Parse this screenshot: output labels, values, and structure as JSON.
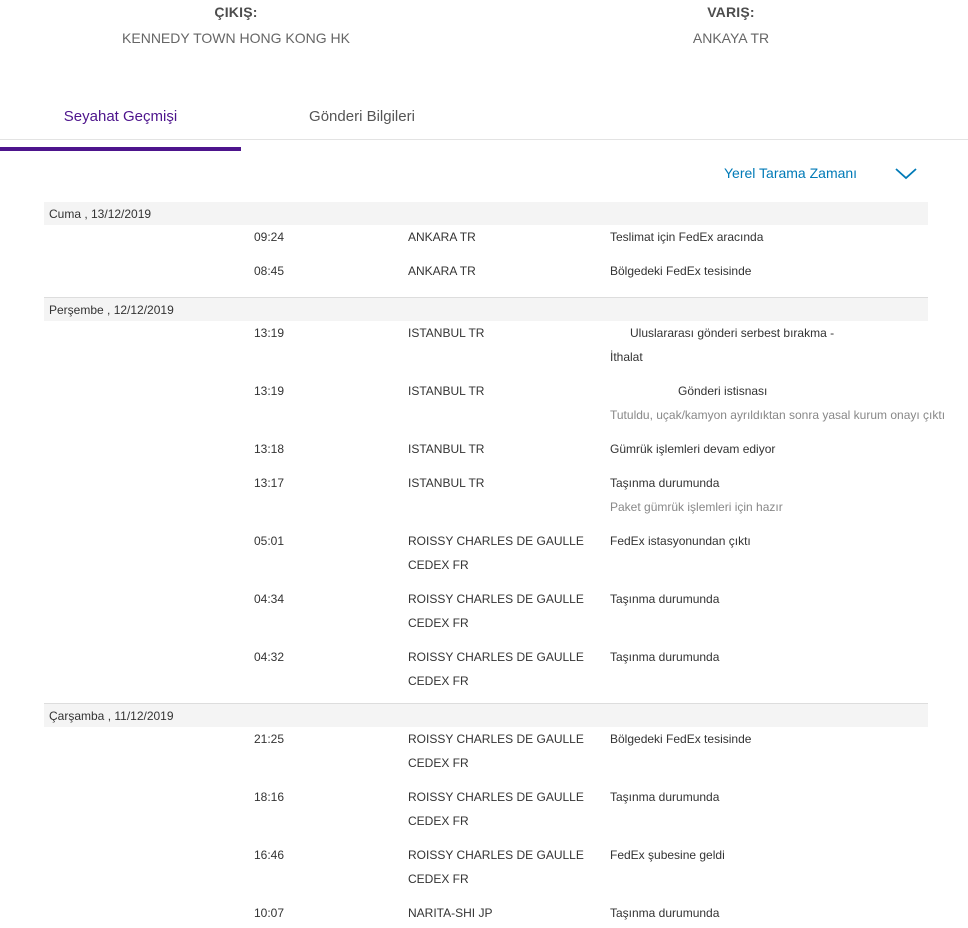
{
  "route": {
    "origin_label": "ÇIKIŞ:",
    "origin_value": "KENNEDY TOWN HONG KONG HK",
    "dest_label": "VARIŞ:",
    "dest_value": "ANKAYA TR"
  },
  "tabs": {
    "travel_history": "Seyahat Geçmişi",
    "shipment_info": "Gönderi Bilgileri"
  },
  "sort": {
    "label": "Yerel Tarama Zamanı",
    "icon": "chevron-down-icon",
    "color": "#007ab7"
  },
  "accent_color": "#4d148c",
  "history": [
    {
      "date": "Cuma , 13/12/2019",
      "events": [
        {
          "time": "09:24",
          "location": "ANKARA TR",
          "status": "Teslimat için FedEx aracında"
        },
        {
          "time": "08:45",
          "location": "ANKARA TR",
          "status": "Bölgedeki FedEx tesisinde"
        }
      ]
    },
    {
      "date": "Perşembe , 12/12/2019",
      "events": [
        {
          "time": "13:19",
          "location": "ISTANBUL TR",
          "status": "Uluslararası gönderi serbest bırakma -",
          "status_line2": "İthalat"
        },
        {
          "time": "13:19",
          "location": "ISTANBUL TR",
          "status": "Gönderi istisnası",
          "detail": "Tutuldu, uçak/kamyon ayrıldıktan sonra yasal kurum onayı çıktı"
        },
        {
          "time": "13:18",
          "location": "ISTANBUL TR",
          "status": "Gümrük işlemleri devam ediyor"
        },
        {
          "time": "13:17",
          "location": "ISTANBUL TR",
          "status": "Taşınma durumunda",
          "detail": "Paket gümrük işlemleri için hazır"
        },
        {
          "time": "05:01",
          "location": "ROISSY CHARLES DE GAULLE",
          "location_line2": "CEDEX FR",
          "status": "FedEx istasyonundan çıktı"
        },
        {
          "time": "04:34",
          "location": "ROISSY CHARLES DE GAULLE",
          "location_line2": "CEDEX FR",
          "status": "Taşınma durumunda"
        },
        {
          "time": "04:32",
          "location": "ROISSY CHARLES DE GAULLE",
          "location_line2": "CEDEX FR",
          "status": "Taşınma durumunda"
        }
      ]
    },
    {
      "date": "Çarşamba , 11/12/2019",
      "events": [
        {
          "time": "21:25",
          "location": "ROISSY CHARLES DE GAULLE",
          "location_line2": "CEDEX FR",
          "status": "Bölgedeki FedEx tesisinde"
        },
        {
          "time": "18:16",
          "location": "ROISSY CHARLES DE GAULLE",
          "location_line2": "CEDEX FR",
          "status": "Taşınma durumunda"
        },
        {
          "time": "16:46",
          "location": "ROISSY CHARLES DE GAULLE",
          "location_line2": "CEDEX FR",
          "status": "FedEx şubesine geldi"
        },
        {
          "time": "10:07",
          "location": "NARITA-SHI JP",
          "status": "Taşınma durumunda"
        }
      ]
    }
  ]
}
